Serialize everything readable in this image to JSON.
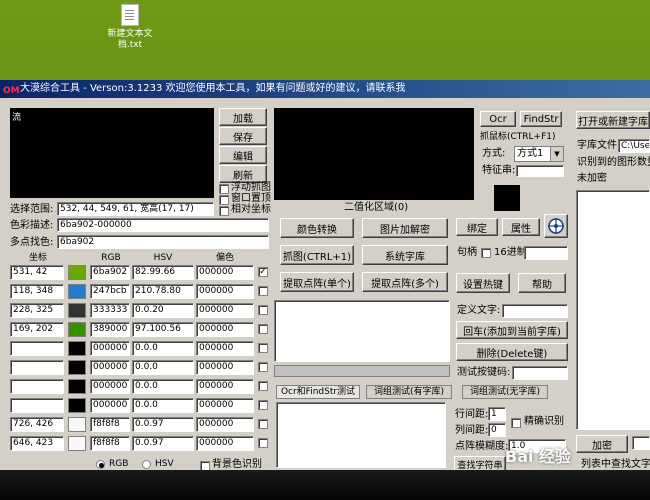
{
  "desktop": {
    "icon_label_1": "新建文本文",
    "icon_label_2": "档.txt"
  },
  "window": {
    "app_icon": "OM",
    "title": "大漠综合工具 - Verson:3.1233 欢迎您使用本工具，如果有问题或好的建议，请联系我"
  },
  "left": {
    "preview_label": "流",
    "buttons": {
      "load": "加载",
      "save": "保存",
      "edit": "编辑",
      "refresh": "刷新"
    },
    "checkboxes": {
      "float": "浮动抓图",
      "window_top": "窗口置顶",
      "relative": "相对坐标"
    },
    "range_label": "选择范围:",
    "range_value": "532, 44, 549, 61, 宽高(17, 17)",
    "color_desc_label": "色彩描述:",
    "color_desc_value": "6ba902-000000",
    "multipoint_label": "多点找色:",
    "multipoint_value": "6ba902",
    "headers": {
      "coord": "坐标",
      "rgb": "RGB",
      "hsv": "HSV",
      "offset": "偏色"
    },
    "rows": [
      {
        "coord": "531, 42",
        "color": "#6ba902",
        "rgb": "6ba902",
        "hsv": "82.99.66",
        "offset": "000000",
        "checked": true
      },
      {
        "coord": "118, 348",
        "color": "#247bcb",
        "rgb": "247bcb",
        "hsv": "210.78.80",
        "offset": "000000",
        "checked": false
      },
      {
        "coord": "228, 325",
        "color": "#333333",
        "rgb": "333333",
        "hsv": "0.0.20",
        "offset": "000000",
        "checked": false
      },
      {
        "coord": "169, 202",
        "color": "#389000",
        "rgb": "389000",
        "hsv": "97.100.56",
        "offset": "000000",
        "checked": false
      },
      {
        "coord": "",
        "color": "#000000",
        "rgb": "000000",
        "hsv": "0.0.0",
        "offset": "000000",
        "checked": false
      },
      {
        "coord": "",
        "color": "#000000",
        "rgb": "000000",
        "hsv": "0.0.0",
        "offset": "000000",
        "checked": false
      },
      {
        "coord": "",
        "color": "#000000",
        "rgb": "000000",
        "hsv": "0.0.0",
        "offset": "000000",
        "checked": false
      },
      {
        "coord": "",
        "color": "#000000",
        "rgb": "000000",
        "hsv": "0.0.0",
        "offset": "000000",
        "checked": false
      },
      {
        "coord": "726, 426",
        "color": "#f8f8f8",
        "rgb": "f8f8f8",
        "hsv": "0.0.97",
        "offset": "000000",
        "checked": false
      },
      {
        "coord": "646, 423",
        "color": "#f8f8f8",
        "rgb": "f8f8f8",
        "hsv": "0.0.97",
        "offset": "000000",
        "checked": false
      }
    ],
    "radio_rgb": "RGB",
    "radio_hsv": "HSV",
    "bg_color_label": "背景色识别"
  },
  "middle": {
    "binarize_label": "二值化区域(0)",
    "buttons": {
      "color_convert": "颜色转换",
      "img_encrypt": "图片加解密",
      "capture": "抓图(CTRL+1)",
      "sys_lib": "系统字库",
      "extract_single": "提取点阵(单个)",
      "extract_multi": "提取点阵(多个)"
    },
    "tabs": [
      "Ocr和FindStr测试",
      "词组测试(有字库)",
      "词组测试(无字库)"
    ]
  },
  "tools": {
    "ocr_btn": "Ocr",
    "findstr_btn": "FindStr",
    "grab_label": "抓鼠标(CTRL+F1)",
    "mode_label": "方式:",
    "mode_value": "方式1",
    "feature_label": "特征串:",
    "bind_btn": "绑定",
    "attr_btn": "属性",
    "sentence_label": "句柄",
    "hex_label": "16进制",
    "hotkey_btn": "设置热键",
    "help_btn": "帮助",
    "define_text_label": "定义文字:",
    "enter_btn": "回车(添加到当前字库)",
    "delete_btn": "删除(Delete键)",
    "test_key_label": "测试按键码:",
    "row_spacing_label": "行间距:",
    "row_spacing_value": "1",
    "col_spacing_label": "列间距:",
    "col_spacing_value": "0",
    "fuzzy_label": "点阵模糊度:",
    "fuzzy_value": "1.0",
    "exact_label": "精确识别",
    "find_btn": "查找字符串"
  },
  "right": {
    "open_lib_btn": "打开或新建字库",
    "lib_file_label": "字库文件:",
    "lib_file_value": "C:\\Use",
    "recognized_label": "识别到的图形数量",
    "unencrypted": "未加密",
    "add_btn": "加密",
    "list_find_label": "列表中查找文字"
  },
  "watermark": "Bai 经验"
}
